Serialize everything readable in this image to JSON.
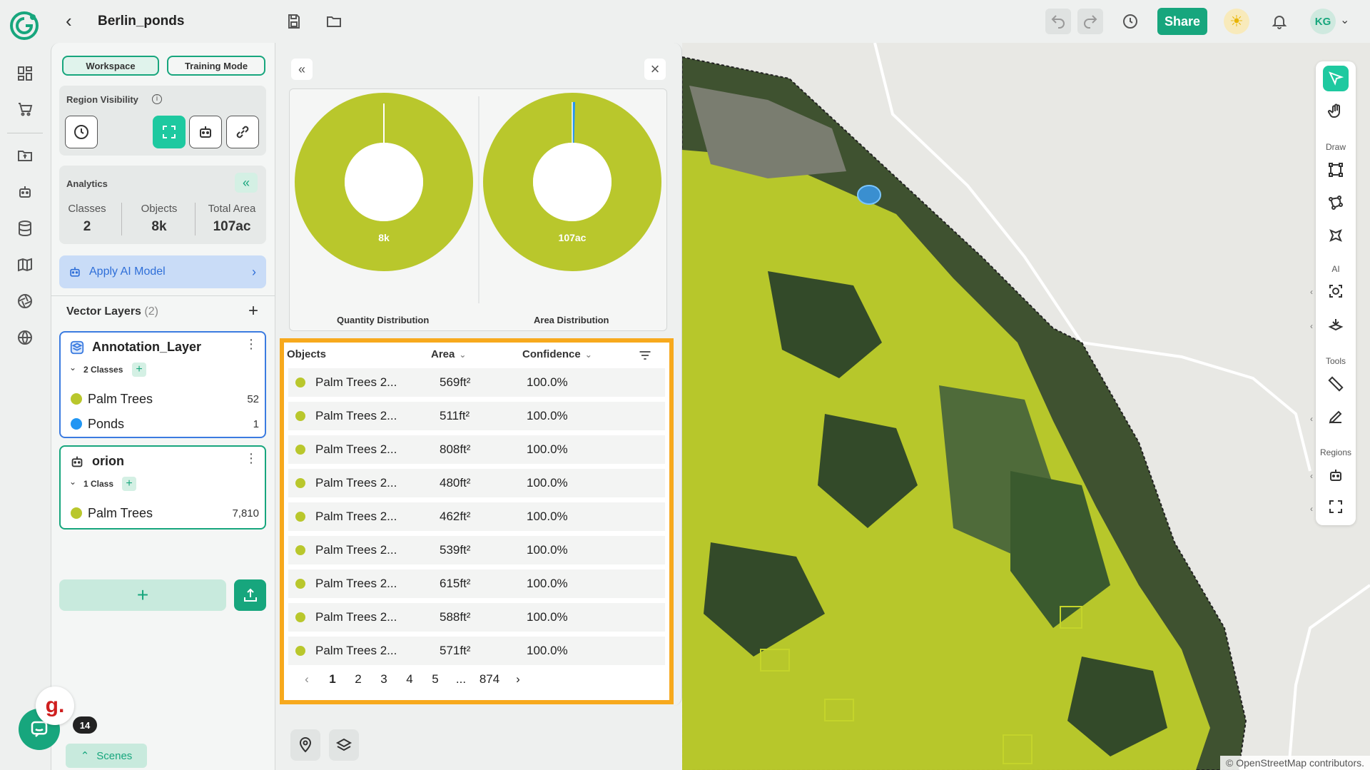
{
  "header": {
    "title": "Berlin_ponds",
    "share_label": "Share",
    "avatar_initials": "KG"
  },
  "left_panel": {
    "workspace_label": "Workspace",
    "training_label": "Training Mode",
    "region_visibility_label": "Region Visibility",
    "analytics": {
      "title": "Analytics",
      "classes_label": "Classes",
      "classes_value": "2",
      "objects_label": "Objects",
      "objects_value": "8k",
      "area_label": "Total Area",
      "area_value": "107ac"
    },
    "apply_ai_label": "Apply AI Model",
    "vector_layers_label": "Vector Layers",
    "vector_layers_count": "(2)",
    "layers": [
      {
        "name": "Annotation_Layer",
        "classes_label": "2 Classes",
        "classes": [
          {
            "name": "Palm Trees",
            "count": "52",
            "color": "#b9c72c"
          },
          {
            "name": "Ponds",
            "count": "1",
            "color": "#2196f3"
          }
        ]
      },
      {
        "name": "orion",
        "classes_label": "1 Class",
        "classes": [
          {
            "name": "Palm Trees",
            "count": "7,810",
            "color": "#b9c72c"
          }
        ]
      }
    ]
  },
  "analytics_panel": {
    "quantity": {
      "label": "Quantity Distribution",
      "center_value": "8k"
    },
    "area": {
      "label": "Area Distribution",
      "center_value": "107ac"
    },
    "table": {
      "headers": {
        "objects": "Objects",
        "area": "Area",
        "confidence": "Confidence"
      },
      "rows": [
        {
          "name": "Palm Trees 2...",
          "area": "569ft²",
          "confidence": "100.0%"
        },
        {
          "name": "Palm Trees 2...",
          "area": "511ft²",
          "confidence": "100.0%"
        },
        {
          "name": "Palm Trees 2...",
          "area": "808ft²",
          "confidence": "100.0%"
        },
        {
          "name": "Palm Trees 2...",
          "area": "480ft²",
          "confidence": "100.0%"
        },
        {
          "name": "Palm Trees 2...",
          "area": "462ft²",
          "confidence": "100.0%"
        },
        {
          "name": "Palm Trees 2...",
          "area": "539ft²",
          "confidence": "100.0%"
        },
        {
          "name": "Palm Trees 2...",
          "area": "615ft²",
          "confidence": "100.0%"
        },
        {
          "name": "Palm Trees 2...",
          "area": "588ft²",
          "confidence": "100.0%"
        },
        {
          "name": "Palm Trees 2...",
          "area": "571ft²",
          "confidence": "100.0%"
        }
      ],
      "pages": [
        "1",
        "2",
        "3",
        "4",
        "5",
        "...",
        "874"
      ],
      "current_page": "1"
    }
  },
  "right_toolbar": {
    "draw_label": "Draw",
    "ai_label": "AI",
    "tools_label": "Tools",
    "regions_label": "Regions"
  },
  "widgets": {
    "badge_letter": "g.",
    "notification_count": "14",
    "scenes_label": "Scenes"
  },
  "map": {
    "attribution": "© OpenStreetMap contributors."
  },
  "colors": {
    "accent": "#17a67d",
    "class_green": "#b9c72c",
    "class_blue": "#2196f3",
    "highlight": "#f7a91d"
  }
}
